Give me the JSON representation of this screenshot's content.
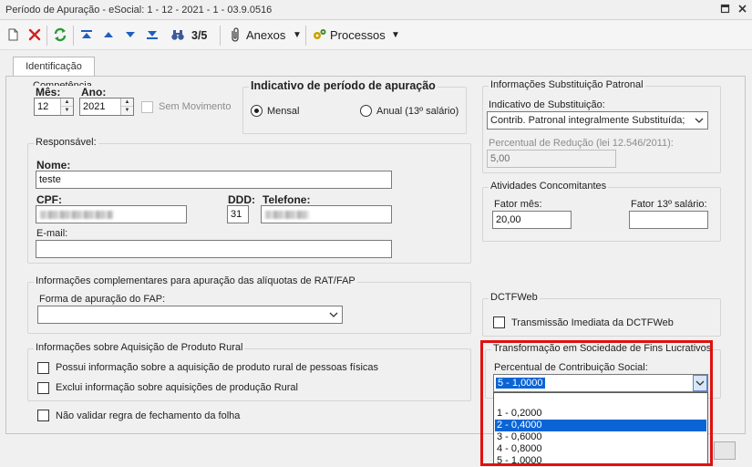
{
  "window": {
    "title": "Período de Apuração - eSocial: 1 - 12 - 2021 - 1 - 03.9.0516"
  },
  "toolbar": {
    "record_position": "3/5",
    "anexos_label": "Anexos",
    "processos_label": "Processos"
  },
  "tabs": [
    {
      "label": "Identificação"
    }
  ],
  "competencia": {
    "title": "Competência",
    "mes_label": "Mês:",
    "mes_value": "12",
    "ano_label": "Ano:",
    "ano_value": "2021",
    "sem_movimento_label": "Sem Movimento"
  },
  "indicativo_periodo": {
    "title": "Indicativo de período de apuração",
    "mensal_label": "Mensal",
    "anual_label": "Anual (13º salário)",
    "selected": "Mensal"
  },
  "substituicao": {
    "title": "Informações Substituição Patronal",
    "indicativo_label": "Indicativo de Substituição:",
    "indicativo_value": "Contrib. Patronal integralmente Substituída;",
    "percentual_label": "Percentual de Redução  (lei 12.546/2011):",
    "percentual_value": "5,00"
  },
  "responsavel": {
    "title": "Responsável:",
    "nome_label": "Nome:",
    "nome_value": "teste",
    "cpf_label": "CPF:",
    "ddd_label": "DDD:",
    "ddd_value": "31",
    "telefone_label": "Telefone:",
    "email_label": "E-mail:"
  },
  "atividades": {
    "title": "Atividades Concomitantes",
    "fator_mes_label": "Fator mês:",
    "fator_mes_value": "20,00",
    "fator_13_label": "Fator 13º salário:"
  },
  "rat_fap": {
    "title": "Informações complementares para apuração das alíquotas de RAT/FAP",
    "forma_label": "Forma de apuração do FAP:"
  },
  "dctfweb": {
    "title": "DCTFWeb",
    "transmissao_label": "Transmissão Imediata da DCTFWeb"
  },
  "produto_rural": {
    "title": "Informações sobre Aquisição de Produto Rural",
    "possui_label": "Possui informação sobre a aquisição de produto rural de pessoas físicas",
    "exclui_label": "Exclui informação sobre aquisições de produção Rural"
  },
  "nao_validar_label": "Não validar regra de fechamento da folha",
  "transformacao": {
    "title": "Transformação em Sociedade de Fins Lucrativos",
    "percentual_label": "Percentual de Contribuição Social:",
    "selected_value": "5 - 1,0000",
    "options": [
      "1 - 0,2000",
      "2 - 0,4000",
      "3 - 0,6000",
      "4 - 0,8000",
      "5 - 1,0000"
    ],
    "highlighted": "2 - 0,4000"
  },
  "colors": {
    "highlight": "#0a64d6",
    "annotation_border": "#e01010",
    "delete_icon": "#d42020",
    "refresh_icon": "#2a9a3a",
    "nav_icon": "#1f5fbf"
  }
}
